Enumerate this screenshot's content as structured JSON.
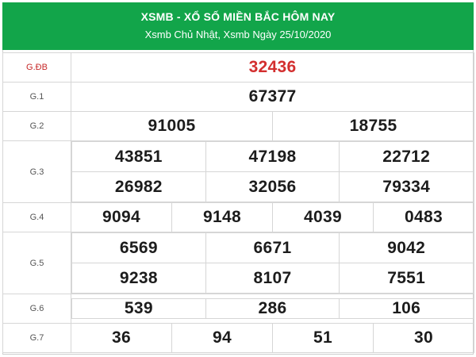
{
  "header": {
    "title": "XSMB - XỔ SỐ MIỀN BẮC HÔM NAY",
    "subtitle": "Xsmb Chủ Nhật, Xsmb Ngày 25/10/2020"
  },
  "colors": {
    "header_bg": "#12a54a",
    "special_prize": "#d32f2f",
    "label_special": "#c62828"
  },
  "prizes": {
    "db": {
      "label": "G.ĐB",
      "values": [
        "32436"
      ]
    },
    "g1": {
      "label": "G.1",
      "values": [
        "67377"
      ]
    },
    "g2": {
      "label": "G.2",
      "values": [
        "91005",
        "18755"
      ]
    },
    "g3": {
      "label": "G.3",
      "values": [
        "43851",
        "47198",
        "22712",
        "26982",
        "32056",
        "79334"
      ]
    },
    "g4": {
      "label": "G.4",
      "values": [
        "9094",
        "9148",
        "4039",
        "0483"
      ]
    },
    "g5": {
      "label": "G.5",
      "values": [
        "6569",
        "6671",
        "9042",
        "9238",
        "8107",
        "7551"
      ]
    },
    "g6": {
      "label": "G.6",
      "values": [
        "539",
        "286",
        "106"
      ]
    },
    "g7": {
      "label": "G.7",
      "values": [
        "36",
        "94",
        "51",
        "30"
      ]
    }
  }
}
